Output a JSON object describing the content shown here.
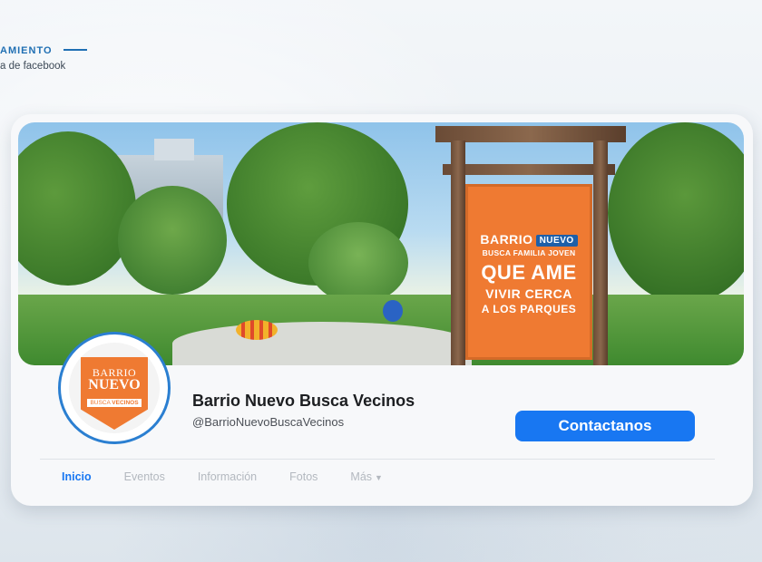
{
  "header": {
    "tag_text": "AMIENTO",
    "subtitle": "a de facebook"
  },
  "cover": {
    "sign": {
      "line1": "BARRIO",
      "badge": "NUEVO",
      "line2": "BUSCA FAMILIA JOVEN",
      "line3": "QUE AME",
      "line4": "VIVIR CERCA",
      "line5": "A LOS PARQUES"
    }
  },
  "profile": {
    "logo": {
      "line1": "BARRIO",
      "line2": "NUEVO",
      "line3_a": "BUSCA",
      "line3_b": "VECINOS"
    },
    "name": "Barrio Nuevo Busca Vecinos",
    "handle": "@BarrioNuevoBuscaVecinos",
    "contact_button": "Contactanos"
  },
  "tabs": [
    {
      "label": "Inicio",
      "active": true
    },
    {
      "label": "Eventos",
      "active": false
    },
    {
      "label": "Información",
      "active": false
    },
    {
      "label": "Fotos",
      "active": false
    },
    {
      "label": "Más",
      "active": false
    }
  ],
  "colors": {
    "accent": "#1877f2",
    "orange": "#ef7a32",
    "ring": "#2b7fd1"
  }
}
